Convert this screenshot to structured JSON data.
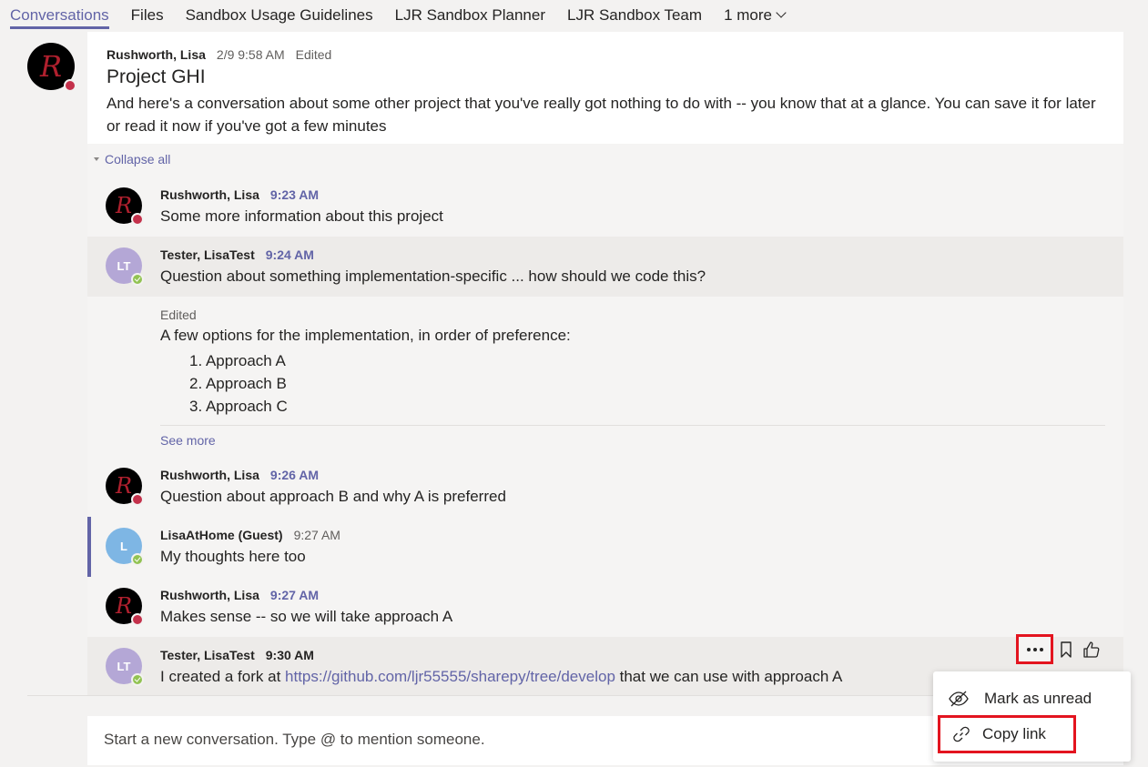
{
  "tabs": [
    {
      "label": "Conversations",
      "active": true
    },
    {
      "label": "Files"
    },
    {
      "label": "Sandbox Usage Guidelines"
    },
    {
      "label": "LJR Sandbox Planner"
    },
    {
      "label": "LJR Sandbox Team"
    },
    {
      "label": "1 more"
    }
  ],
  "root": {
    "author": "Rushworth, Lisa",
    "timestamp": "2/9 9:58 AM",
    "edited": "Edited",
    "title": "Project GHI",
    "body": "And here's a conversation about some other project that you've really got nothing to do with -- you know that at a glance. You can save it for later or read it now if you've got a few minutes"
  },
  "thread": {
    "collapse_label": "Collapse all",
    "replies": [
      {
        "author": "Rushworth, Lisa",
        "time": "9:23 AM",
        "text": "Some more information about this project"
      },
      {
        "author": "Tester, LisaTest",
        "initials": "LT",
        "time": "9:24 AM",
        "text": "Question about something implementation-specific ... how should we code this?"
      },
      {
        "author": "Rushworth, Lisa",
        "time": "9:26 AM",
        "text": "Question about approach B and why A is preferred"
      },
      {
        "author": "LisaAtHome (Guest)",
        "initials": "L",
        "time": "9:27 AM",
        "text": "My thoughts here too"
      },
      {
        "author": "Rushworth, Lisa",
        "time": "9:27 AM",
        "text": "Makes sense -- so we will take approach A"
      },
      {
        "author": "Tester, LisaTest",
        "initials": "LT",
        "time": "9:30 AM",
        "text_before": "I created a fork at ",
        "link": "https://github.com/ljr55555/sharepy/tree/develop",
        "text_after": " that we can use with approach A"
      }
    ],
    "edited_reply": {
      "edited": "Edited",
      "intro": "A few options for the implementation, in order of preference:",
      "options": [
        "1. Approach A",
        "2. Approach B",
        "3. Approach C"
      ],
      "see_more": "See more"
    }
  },
  "compose": {
    "placeholder": "Start a new conversation. Type @ to mention someone."
  },
  "context_menu": {
    "items": [
      {
        "label": "Mark as unread",
        "icon": "mark-unread-icon"
      },
      {
        "label": "Copy link",
        "icon": "link-icon"
      }
    ]
  },
  "colors": {
    "accent": "#6264a7",
    "highlight_box": "#e3141f",
    "busy": "#c4314b",
    "available": "#92c353"
  }
}
